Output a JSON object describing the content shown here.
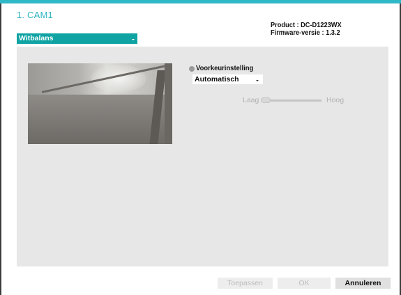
{
  "header": {
    "camera_title": "1. CAM1",
    "product": "Product : DC-D1223WX",
    "firmware": "Firmware-versie : 1.3.2"
  },
  "mode_select": {
    "value": "Witbalans"
  },
  "white_balance": {
    "preset_label": "Voorkeurinstelling",
    "preset_value": "Automatisch",
    "slider_low_label": "Laag",
    "slider_high_label": "Hoog"
  },
  "footer": {
    "apply_label": "Toepassen",
    "ok_label": "OK",
    "cancel_label": "Annuleren"
  },
  "colors": {
    "accent": "#2fb8c6",
    "select_background": "#0fa3a3",
    "panel_background": "#e7e7e7"
  }
}
